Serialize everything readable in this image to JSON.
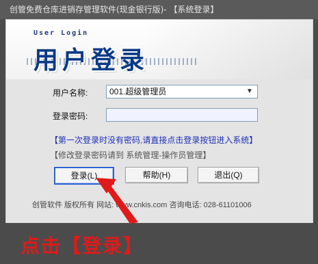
{
  "window": {
    "title": "创管免费仓库进销存管理软件(现金银行版)- 【系统登录】"
  },
  "banner": {
    "subtitle": "User Login",
    "heading": "用户登录"
  },
  "form": {
    "username_label": "用户名称:",
    "username_value": "001.超级管理员",
    "password_label": "登录密码:",
    "password_value": ""
  },
  "hints": {
    "first_login": "【第一次登录时没有密码,请直接点击登录按钮进入系统】",
    "change_password": "【修改登录密码请到 系统管理-操作员管理】"
  },
  "buttons": {
    "login": "登录(L)",
    "help": "帮助(H)",
    "exit": "退出(Q)"
  },
  "footer": {
    "text": "创管软件  版权所有  网站: www.cnkis.com  咨询电话: 028-61101006"
  },
  "annotation": {
    "text": "点击【登录】"
  }
}
